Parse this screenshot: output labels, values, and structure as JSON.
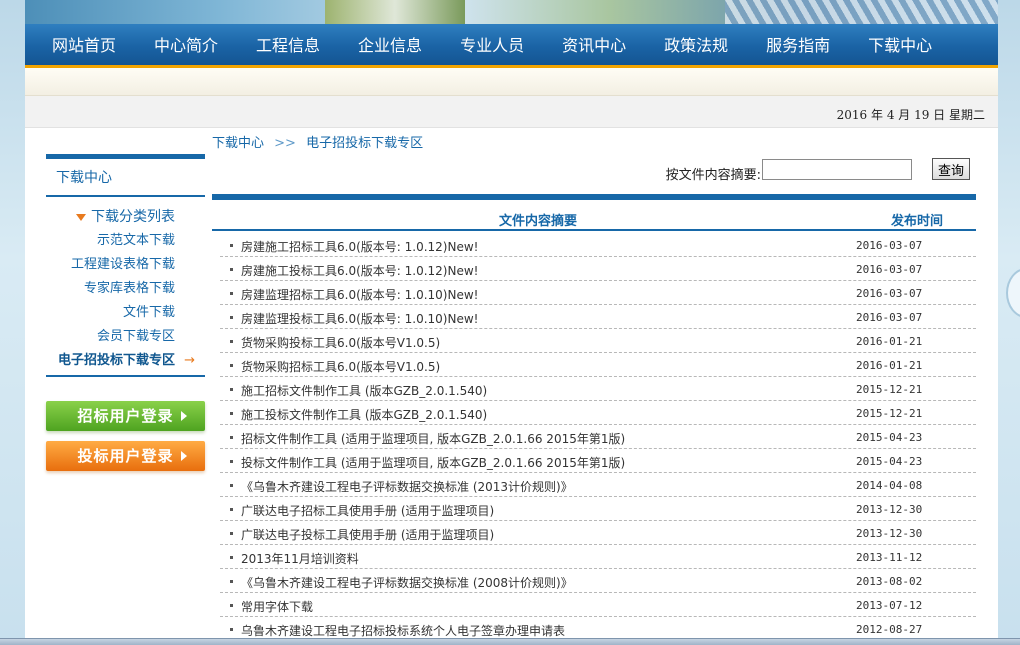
{
  "nav": {
    "items": [
      "网站首页",
      "中心简介",
      "工程信息",
      "企业信息",
      "专业人员",
      "资讯中心",
      "政策法规",
      "服务指南",
      "下载中心"
    ]
  },
  "date": "2016 年 4 月 19 日 星期二",
  "breadcrumb": {
    "home": "下载中心",
    "sep": ">>",
    "current": "电子招投标下载专区"
  },
  "sidebar": {
    "title": "下载中心",
    "sub_title": "下载分类列表",
    "items": [
      "示范文本下载",
      "工程建设表格下载",
      "专家库表格下载",
      "文件下载",
      "会员下载专区",
      "电子招投标下载专区"
    ],
    "active_arrow": "→",
    "login_bidder": "招标用户登录",
    "login_tender": "投标用户登录"
  },
  "search": {
    "label": "按文件内容摘要:",
    "value": "",
    "button": "查询"
  },
  "table": {
    "col_title": "文件内容摘要",
    "col_date": "发布时间",
    "rows": [
      {
        "title": "房建施工招标工具6.0(版本号: 1.0.12)New!",
        "date": "2016-03-07"
      },
      {
        "title": "房建施工投标工具6.0(版本号: 1.0.12)New!",
        "date": "2016-03-07"
      },
      {
        "title": "房建监理招标工具6.0(版本号: 1.0.10)New!",
        "date": "2016-03-07"
      },
      {
        "title": "房建监理投标工具6.0(版本号: 1.0.10)New!",
        "date": "2016-03-07"
      },
      {
        "title": "货物采购投标工具6.0(版本号V1.0.5)",
        "date": "2016-01-21"
      },
      {
        "title": "货物采购招标工具6.0(版本号V1.0.5)",
        "date": "2016-01-21"
      },
      {
        "title": "施工招标文件制作工具 (版本GZB_2.0.1.540)",
        "date": "2015-12-21"
      },
      {
        "title": "施工投标文件制作工具 (版本GZB_2.0.1.540)",
        "date": "2015-12-21"
      },
      {
        "title": "招标文件制作工具 (适用于监理项目, 版本GZB_2.0.1.66 2015年第1版)",
        "date": "2015-04-23"
      },
      {
        "title": "投标文件制作工具 (适用于监理项目, 版本GZB_2.0.1.66 2015年第1版)",
        "date": "2015-04-23"
      },
      {
        "title": "《乌鲁木齐建设工程电子评标数据交换标准 (2013计价规则)》",
        "date": "2014-04-08"
      },
      {
        "title": "广联达电子招标工具使用手册 (适用于监理项目)",
        "date": "2013-12-30"
      },
      {
        "title": "广联达电子投标工具使用手册 (适用于监理项目)",
        "date": "2013-12-30"
      },
      {
        "title": "2013年11月培训资料",
        "date": "2013-11-12"
      },
      {
        "title": "《乌鲁木齐建设工程电子评标数据交换标准 (2008计价规则)》",
        "date": "2013-08-02"
      },
      {
        "title": "常用字体下载",
        "date": "2013-07-12"
      },
      {
        "title": "乌鲁木齐建设工程电子招标投标系统个人电子签章办理申请表",
        "date": "2012-08-27"
      }
    ]
  }
}
